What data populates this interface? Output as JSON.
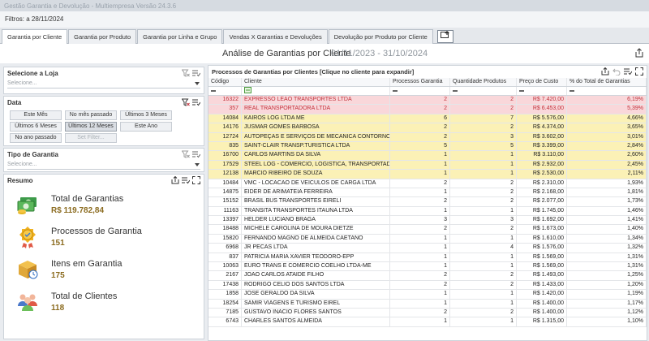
{
  "window": {
    "title": "Gestão Garantia e Devolução - Multiempresa Versão 24.3.6"
  },
  "filter": {
    "label": "Filtros:",
    "value": "a 28/11/2024"
  },
  "tabs": [
    {
      "label": "Garantia por Cliente",
      "active": true
    },
    {
      "label": "Garantia por Produto"
    },
    {
      "label": "Garantia por Linha e Grupo"
    },
    {
      "label": "Vendas X Garantias e Devoluções"
    },
    {
      "label": "Devolução por Produto por Cliente"
    }
  ],
  "header": {
    "title": "Análise de Garantias por Cliente",
    "range": "01/11/2023 - 31/10/2024"
  },
  "store": {
    "title": "Selecione a Loja",
    "placeholder": "Selecione..."
  },
  "date": {
    "title": "Data",
    "buttons": [
      "Este Mês",
      "No mês passado",
      "Últimos 3 Meses",
      "Últimos 6 Meses",
      "Últimos 12 Meses",
      "Este Ano",
      "No ano passado",
      "Set Filter..."
    ],
    "selected": "Últimos 12 Meses"
  },
  "warranty_type": {
    "title": "Tipo de Garantia",
    "placeholder": "Selecione..."
  },
  "summary": {
    "title": "Resumo",
    "items": [
      {
        "label": "Total de Garantias",
        "value": "R$ 119.782,84",
        "icon": "money-icon"
      },
      {
        "label": "Processos de Garantia",
        "value": "151",
        "icon": "badge-icon"
      },
      {
        "label": "Itens em Garantia",
        "value": "175",
        "icon": "box-icon"
      },
      {
        "label": "Total de Clientes",
        "value": "118",
        "icon": "people-icon"
      }
    ]
  },
  "grid": {
    "title": "Processos de Garantias por Clientes [Clique no cliente para expandir]",
    "columns": [
      "Código",
      "Cliente",
      "Processos Garantia",
      "Quantidade Produtos",
      "Preço de Custo",
      "% do Total de Garantias"
    ],
    "rows": [
      [
        "16322",
        "EXPRESSO LEAO TRANSPORTES LTDA",
        "2",
        "2",
        "R$ 7.420,00",
        "6,19%",
        "red"
      ],
      [
        "357",
        "REAL TRANSPORTADORA LTDA",
        "2",
        "2",
        "R$ 6.453,00",
        "5,39%",
        "red"
      ],
      [
        "14084",
        "KAIROS LOG LTDA ME",
        "6",
        "7",
        "R$ 5.576,00",
        "4,66%",
        "yellow"
      ],
      [
        "14176",
        "JUSMAR GOMES BARBOSA",
        "2",
        "2",
        "R$ 4.374,00",
        "3,65%",
        "yellow"
      ],
      [
        "12724",
        "AUTOPEÇAS  E SERVIÇOS DE MECANICA CONTORNO LTDA",
        "2",
        "3",
        "R$ 3.602,00",
        "3,01%",
        "yellow"
      ],
      [
        "835",
        "SAINT-CLAIR TRANSP.TURISTICA LTDA",
        "5",
        "5",
        "R$ 3.399,00",
        "2,84%",
        "yellow"
      ],
      [
        "16700",
        "CARLOS MARTINS DA SILVA",
        "1",
        "1",
        "R$ 3.110,00",
        "2,60%",
        "yellow"
      ],
      [
        "17529",
        "STEEL LOG - COMERCIO, LOGISTICA, TRANSPORTADORA E",
        "1",
        "1",
        "R$ 2.932,00",
        "2,45%",
        "yellow"
      ],
      [
        "12138",
        "MARCIO  RIBEIRO  DE  SOUZA",
        "1",
        "1",
        "R$ 2.530,00",
        "2,11%",
        "yellow"
      ],
      [
        "10484",
        "VMC - LOCACAO DE VEICULOS DE CARGA LTDA",
        "2",
        "2",
        "R$ 2.310,00",
        "1,93%",
        ""
      ],
      [
        "14875",
        "EIDER DE ARIMATEIA FERREIRA",
        "1",
        "2",
        "R$ 2.168,00",
        "1,81%",
        ""
      ],
      [
        "15152",
        "BRASIL BUS TRANSPORTES EIRELI",
        "2",
        "2",
        "R$ 2.077,00",
        "1,73%",
        ""
      ],
      [
        "11163",
        "TRANSITA TRANSPORTES ITAUNA LTDA",
        "1",
        "1",
        "R$ 1.745,00",
        "1,46%",
        ""
      ],
      [
        "13397",
        "HELDER LUCIANO BRAGA",
        "3",
        "3",
        "R$ 1.692,00",
        "1,41%",
        ""
      ],
      [
        "18488",
        "MICHELE CAROLINA DE MOURA DIETZE",
        "2",
        "2",
        "R$ 1.673,00",
        "1,40%",
        ""
      ],
      [
        "15820",
        "FERNANDO MAGNO DE ALMEIDA CAETANO",
        "1",
        "1",
        "R$ 1.610,00",
        "1,34%",
        ""
      ],
      [
        "6968",
        "JR PECAS LTDA",
        "1",
        "4",
        "R$ 1.576,00",
        "1,32%",
        ""
      ],
      [
        "837",
        "PATRICIA MARIA XAVIER TEODORO-EPP",
        "1",
        "1",
        "R$ 1.569,00",
        "1,31%",
        ""
      ],
      [
        "10063",
        "EURO TRANS E COMERCIO COELHO LTDA-ME",
        "1",
        "1",
        "R$ 1.569,00",
        "1,31%",
        ""
      ],
      [
        "2167",
        "JOAO CARLOS ATAIDE FILHO",
        "2",
        "2",
        "R$ 1.493,00",
        "1,25%",
        ""
      ],
      [
        "17438",
        "RODRIGO CELIO DOS SANTOS LTDA",
        "2",
        "2",
        "R$ 1.433,00",
        "1,20%",
        ""
      ],
      [
        "1858",
        "JOSE GERALDO DA SILVA",
        "1",
        "1",
        "R$ 1.420,00",
        "1,19%",
        ""
      ],
      [
        "18254",
        "SAMIR VIAGENS E TURISMO EIREL",
        "1",
        "1",
        "R$ 1.400,00",
        "1,17%",
        ""
      ],
      [
        "7185",
        "GUSTAVO INACIO FLORES SANTOS",
        "2",
        "2",
        "R$ 1.400,00",
        "1,12%",
        ""
      ],
      [
        "6743",
        "CHARLES SANTOS ALMEIDA",
        "1",
        "1",
        "R$ 1.315,00",
        "1,10%",
        ""
      ]
    ]
  }
}
